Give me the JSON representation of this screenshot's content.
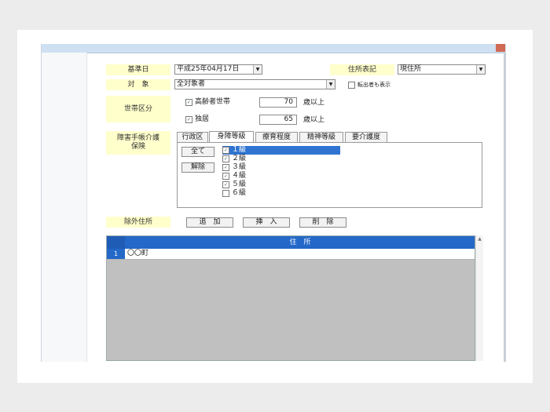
{
  "form": {
    "kijunbi": {
      "label": "基準日",
      "value": "平成25年04月17日"
    },
    "jusho_hyoki": {
      "label": "住所表記",
      "value": "現住所"
    },
    "taisho": {
      "label": "対　象",
      "value": "全対象者"
    },
    "show_transferred": {
      "label": "転出者も表示",
      "checked": false
    },
    "setai_kubun": {
      "label": "世帯区分",
      "elderly": {
        "label": "高齢者世帯",
        "checked": true,
        "age": "70",
        "unit": "歳以上"
      },
      "single": {
        "label": "独居",
        "checked": true,
        "age": "65",
        "unit": "歳以上"
      }
    },
    "shogai_label": "障害手帳介護保険",
    "tabs": [
      "行政区",
      "身障等級",
      "療育程度",
      "精神等級",
      "要介護度"
    ],
    "active_tab": 1,
    "select_all_label": "全て",
    "deselect_label": "解除",
    "grades": [
      {
        "label": "１級",
        "checked": true,
        "selected": true
      },
      {
        "label": "２級",
        "checked": true,
        "selected": false
      },
      {
        "label": "３級",
        "checked": true,
        "selected": false
      },
      {
        "label": "４級",
        "checked": true,
        "selected": false
      },
      {
        "label": "５級",
        "checked": true,
        "selected": false
      },
      {
        "label": "６級",
        "checked": false,
        "selected": false
      }
    ],
    "exclude_address_label": "除外住所",
    "buttons": {
      "add": "追　加",
      "insert": "挿　入",
      "delete": "削　除"
    }
  },
  "grid": {
    "header": "住　所",
    "rows": [
      {
        "num": "1",
        "address": "〇〇町"
      }
    ]
  },
  "colors": {
    "label_bg": "#ffffcc",
    "header_blue": "#2468c8",
    "selection_blue": "#2f74d0",
    "grid_empty": "#c0c0c0"
  }
}
